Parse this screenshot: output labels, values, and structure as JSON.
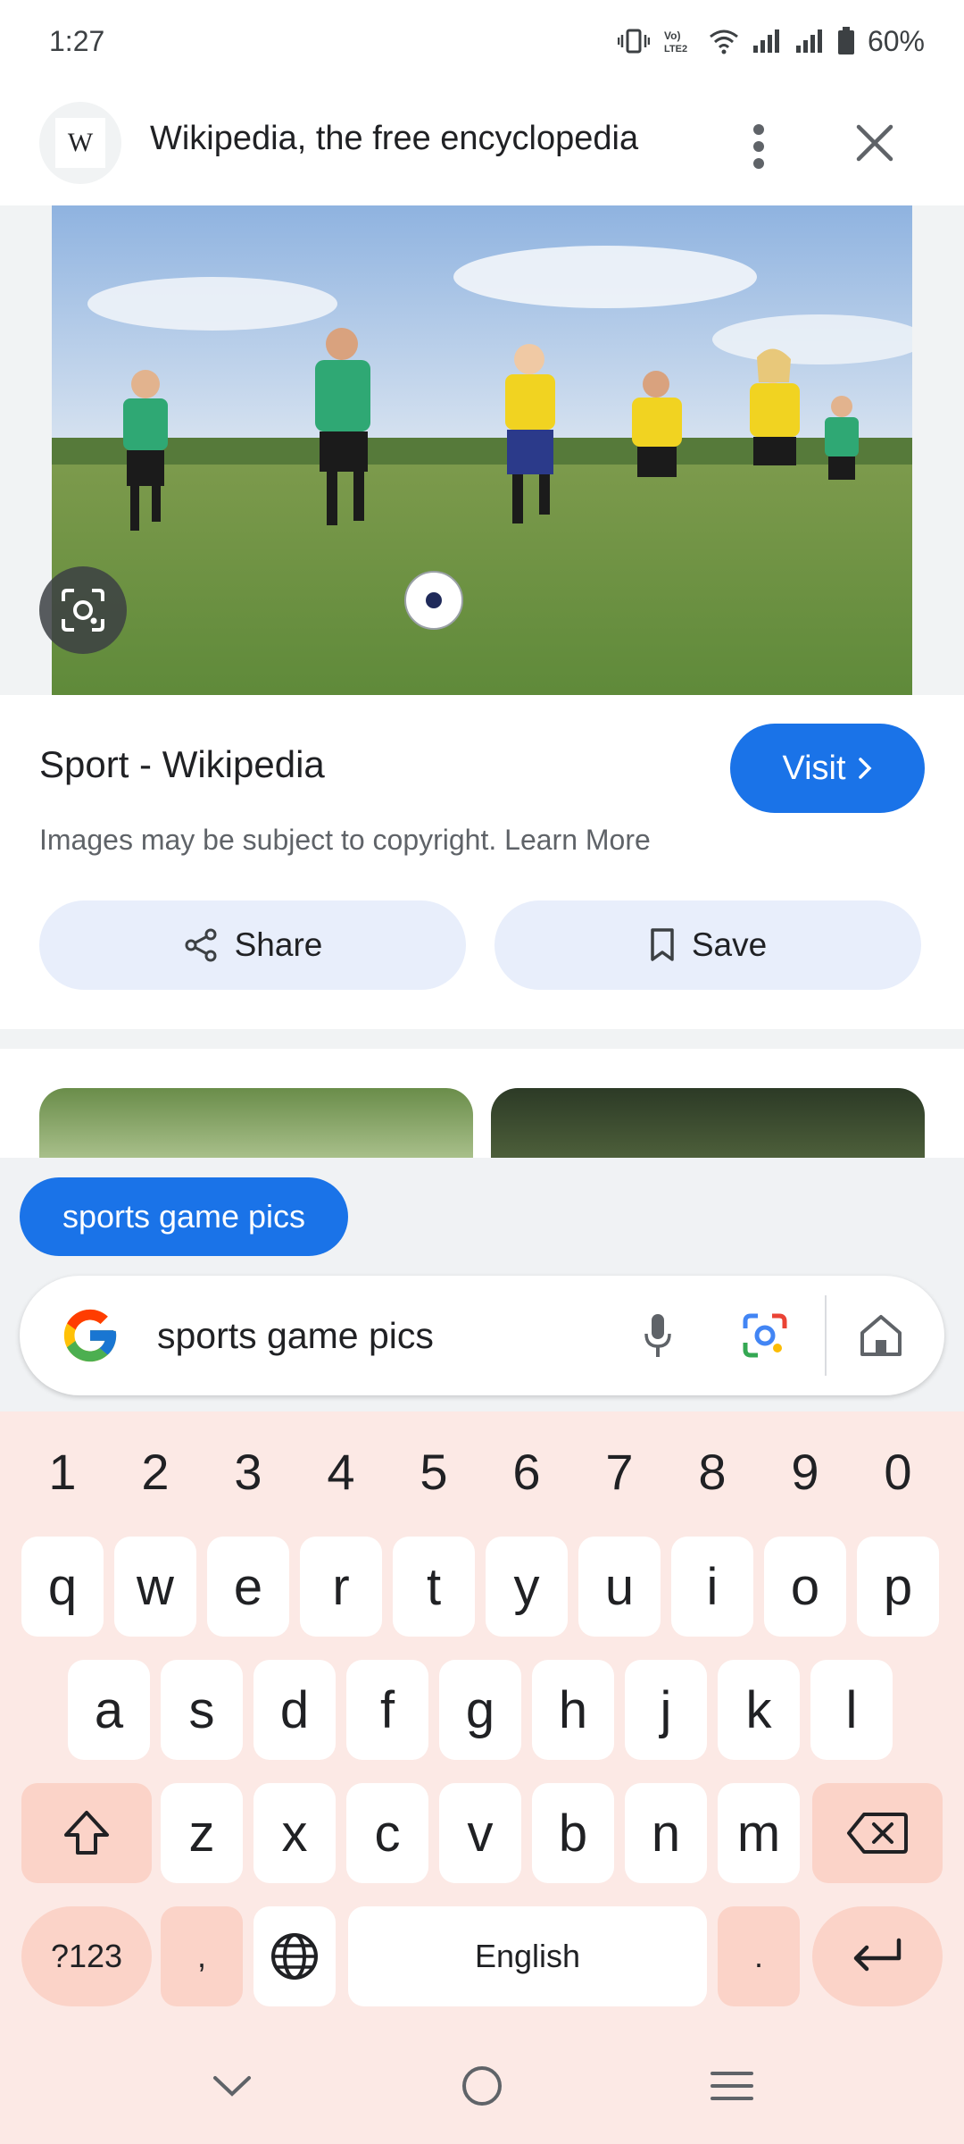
{
  "status_bar": {
    "time": "1:27",
    "battery": "60%"
  },
  "header": {
    "logo": "W",
    "title": "Wikipedia, the free encyclopedia"
  },
  "result": {
    "title": "Sport - Wikipedia",
    "visit_label": "Visit",
    "copyright": "Images may be subject to copyright. Learn More",
    "share_label": "Share",
    "save_label": "Save"
  },
  "search": {
    "chip_label": "sports game pics",
    "query": "sports game pics"
  },
  "keyboard": {
    "numbers": [
      "1",
      "2",
      "3",
      "4",
      "5",
      "6",
      "7",
      "8",
      "9",
      "0"
    ],
    "row1": [
      "q",
      "w",
      "e",
      "r",
      "t",
      "y",
      "u",
      "i",
      "o",
      "p"
    ],
    "row2": [
      "a",
      "s",
      "d",
      "f",
      "g",
      "h",
      "j",
      "k",
      "l"
    ],
    "row3": [
      "z",
      "x",
      "c",
      "v",
      "b",
      "n",
      "m"
    ],
    "symbols_label": "?123",
    "comma": ",",
    "space_label": "English",
    "period": "."
  },
  "colors": {
    "accent": "#1a73e8",
    "keyboard_bg": "#fce9e5",
    "fn_key": "#fbd3c8",
    "chip_bg": "#e8eefb"
  }
}
